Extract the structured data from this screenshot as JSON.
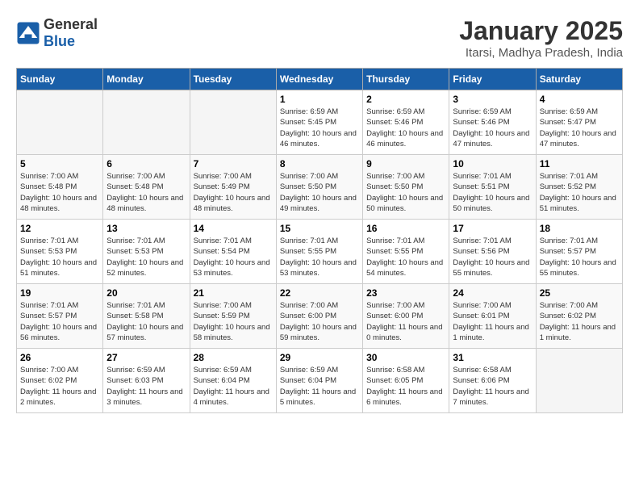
{
  "header": {
    "logo": {
      "text_general": "General",
      "text_blue": "Blue"
    },
    "title": "January 2025",
    "subtitle": "Itarsi, Madhya Pradesh, India"
  },
  "calendar": {
    "days_of_week": [
      "Sunday",
      "Monday",
      "Tuesday",
      "Wednesday",
      "Thursday",
      "Friday",
      "Saturday"
    ],
    "weeks": [
      [
        {
          "day": "",
          "info": ""
        },
        {
          "day": "",
          "info": ""
        },
        {
          "day": "",
          "info": ""
        },
        {
          "day": "1",
          "info": "Sunrise: 6:59 AM\nSunset: 5:45 PM\nDaylight: 10 hours and 46 minutes."
        },
        {
          "day": "2",
          "info": "Sunrise: 6:59 AM\nSunset: 5:46 PM\nDaylight: 10 hours and 46 minutes."
        },
        {
          "day": "3",
          "info": "Sunrise: 6:59 AM\nSunset: 5:46 PM\nDaylight: 10 hours and 47 minutes."
        },
        {
          "day": "4",
          "info": "Sunrise: 6:59 AM\nSunset: 5:47 PM\nDaylight: 10 hours and 47 minutes."
        }
      ],
      [
        {
          "day": "5",
          "info": "Sunrise: 7:00 AM\nSunset: 5:48 PM\nDaylight: 10 hours and 48 minutes."
        },
        {
          "day": "6",
          "info": "Sunrise: 7:00 AM\nSunset: 5:48 PM\nDaylight: 10 hours and 48 minutes."
        },
        {
          "day": "7",
          "info": "Sunrise: 7:00 AM\nSunset: 5:49 PM\nDaylight: 10 hours and 48 minutes."
        },
        {
          "day": "8",
          "info": "Sunrise: 7:00 AM\nSunset: 5:50 PM\nDaylight: 10 hours and 49 minutes."
        },
        {
          "day": "9",
          "info": "Sunrise: 7:00 AM\nSunset: 5:50 PM\nDaylight: 10 hours and 50 minutes."
        },
        {
          "day": "10",
          "info": "Sunrise: 7:01 AM\nSunset: 5:51 PM\nDaylight: 10 hours and 50 minutes."
        },
        {
          "day": "11",
          "info": "Sunrise: 7:01 AM\nSunset: 5:52 PM\nDaylight: 10 hours and 51 minutes."
        }
      ],
      [
        {
          "day": "12",
          "info": "Sunrise: 7:01 AM\nSunset: 5:53 PM\nDaylight: 10 hours and 51 minutes."
        },
        {
          "day": "13",
          "info": "Sunrise: 7:01 AM\nSunset: 5:53 PM\nDaylight: 10 hours and 52 minutes."
        },
        {
          "day": "14",
          "info": "Sunrise: 7:01 AM\nSunset: 5:54 PM\nDaylight: 10 hours and 53 minutes."
        },
        {
          "day": "15",
          "info": "Sunrise: 7:01 AM\nSunset: 5:55 PM\nDaylight: 10 hours and 53 minutes."
        },
        {
          "day": "16",
          "info": "Sunrise: 7:01 AM\nSunset: 5:55 PM\nDaylight: 10 hours and 54 minutes."
        },
        {
          "day": "17",
          "info": "Sunrise: 7:01 AM\nSunset: 5:56 PM\nDaylight: 10 hours and 55 minutes."
        },
        {
          "day": "18",
          "info": "Sunrise: 7:01 AM\nSunset: 5:57 PM\nDaylight: 10 hours and 55 minutes."
        }
      ],
      [
        {
          "day": "19",
          "info": "Sunrise: 7:01 AM\nSunset: 5:57 PM\nDaylight: 10 hours and 56 minutes."
        },
        {
          "day": "20",
          "info": "Sunrise: 7:01 AM\nSunset: 5:58 PM\nDaylight: 10 hours and 57 minutes."
        },
        {
          "day": "21",
          "info": "Sunrise: 7:00 AM\nSunset: 5:59 PM\nDaylight: 10 hours and 58 minutes."
        },
        {
          "day": "22",
          "info": "Sunrise: 7:00 AM\nSunset: 6:00 PM\nDaylight: 10 hours and 59 minutes."
        },
        {
          "day": "23",
          "info": "Sunrise: 7:00 AM\nSunset: 6:00 PM\nDaylight: 11 hours and 0 minutes."
        },
        {
          "day": "24",
          "info": "Sunrise: 7:00 AM\nSunset: 6:01 PM\nDaylight: 11 hours and 1 minute."
        },
        {
          "day": "25",
          "info": "Sunrise: 7:00 AM\nSunset: 6:02 PM\nDaylight: 11 hours and 1 minute."
        }
      ],
      [
        {
          "day": "26",
          "info": "Sunrise: 7:00 AM\nSunset: 6:02 PM\nDaylight: 11 hours and 2 minutes."
        },
        {
          "day": "27",
          "info": "Sunrise: 6:59 AM\nSunset: 6:03 PM\nDaylight: 11 hours and 3 minutes."
        },
        {
          "day": "28",
          "info": "Sunrise: 6:59 AM\nSunset: 6:04 PM\nDaylight: 11 hours and 4 minutes."
        },
        {
          "day": "29",
          "info": "Sunrise: 6:59 AM\nSunset: 6:04 PM\nDaylight: 11 hours and 5 minutes."
        },
        {
          "day": "30",
          "info": "Sunrise: 6:58 AM\nSunset: 6:05 PM\nDaylight: 11 hours and 6 minutes."
        },
        {
          "day": "31",
          "info": "Sunrise: 6:58 AM\nSunset: 6:06 PM\nDaylight: 11 hours and 7 minutes."
        },
        {
          "day": "",
          "info": ""
        }
      ]
    ]
  }
}
